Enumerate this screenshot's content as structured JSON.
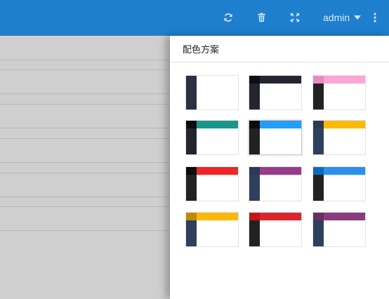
{
  "topbar": {
    "username": "admin",
    "icons": [
      "refresh-icon",
      "trash-icon",
      "fullscreen-icon",
      "more-vertical-icon"
    ],
    "color": "#1e7fcf"
  },
  "panel": {
    "title": "配色方案",
    "active_scheme": 4,
    "schemes": [
      {
        "logo": "#2a3140",
        "header": "#ffffff",
        "sidebar": "#2a3140"
      },
      {
        "logo": "#0d0f12",
        "header": "#23262e",
        "sidebar": "#23262e"
      },
      {
        "logo": "#e48cbf",
        "header": "#f9a8d4",
        "sidebar": "#222222"
      },
      {
        "logo": "#0c0c0c",
        "header": "#16998c",
        "sidebar": "#23262e"
      },
      {
        "logo": "#0c0c0c",
        "header": "#1e9fff",
        "sidebar": "#222222"
      },
      {
        "logo": "#2a3a55",
        "header": "#ffb800",
        "sidebar": "#2f3f5e"
      },
      {
        "logo": "#0c0c0c",
        "header": "#f22525",
        "sidebar": "#222222"
      },
      {
        "logo": "#2a3a55",
        "header": "#993b8a",
        "sidebar": "#2f3f5e"
      },
      {
        "logo": "#0d6bb7",
        "header": "#2b8ff0",
        "sidebar": "#222222"
      },
      {
        "logo": "#c08a00",
        "header": "#ffb800",
        "sidebar": "#2f3f5e"
      },
      {
        "logo": "#c8141a",
        "header": "#e4222a",
        "sidebar": "#222222"
      },
      {
        "logo": "#6a2e62",
        "header": "#8b3a80",
        "sidebar": "#2f3f5e"
      }
    ]
  }
}
